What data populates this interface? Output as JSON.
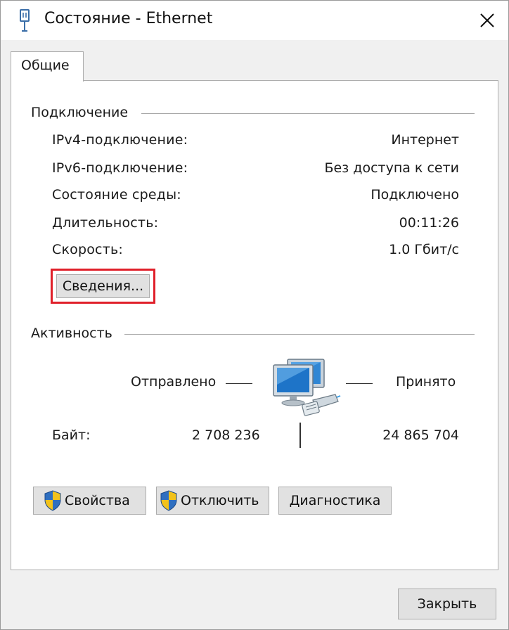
{
  "window": {
    "title": "Состояние - Ethernet",
    "icon": "network-adapter-icon",
    "close_icon": "close-icon"
  },
  "tabs": [
    {
      "label": "Общие",
      "selected": true
    }
  ],
  "connection": {
    "group_title": "Подключение",
    "rows": [
      {
        "label": "IPv4-подключение:",
        "value": "Интернет"
      },
      {
        "label": "IPv6-подключение:",
        "value": "Без доступа к сети"
      },
      {
        "label": "Состояние среды:",
        "value": "Подключено"
      },
      {
        "label": "Длительность:",
        "value": "00:11:26"
      },
      {
        "label": "Скорость:",
        "value": "1.0 Гбит/с"
      }
    ],
    "details_button": "Сведения...",
    "highlight_color": "#e0202a"
  },
  "activity": {
    "group_title": "Активность",
    "sent_label": "Отправлено",
    "received_label": "Принято",
    "bytes_label": "Байт:",
    "bytes_sent": "2 708 236",
    "bytes_received": "24 865 704",
    "icon": "network-computers-icon"
  },
  "actions": {
    "properties": "Свойства",
    "disable": "Отключить",
    "diagnose": "Диагностика",
    "shield_icon": "uac-shield-icon"
  },
  "footer": {
    "close": "Закрыть"
  }
}
